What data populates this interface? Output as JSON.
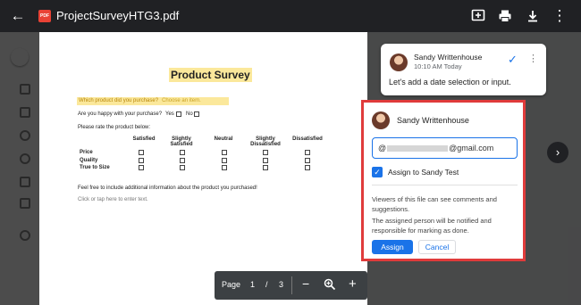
{
  "topbar": {
    "back_icon": "arrow-left-icon",
    "pdf_badge": "PDF",
    "file_title": "ProjectSurveyHTG3.pdf",
    "actions": [
      "add-comment-icon",
      "print-icon",
      "download-icon",
      "more-vert-icon"
    ]
  },
  "document": {
    "title": "Product Survey",
    "q1": "Which product did you purchase?",
    "q1_placeholder": "Choose an item.",
    "q2": "Are you happy with your purchase?",
    "yes": "Yes",
    "no": "No",
    "q3": "Please rate the product below:",
    "rating_columns": [
      "Satisfied",
      "Slightly Satisfied",
      "Neutral",
      "Slightly Dissatisfied",
      "Dissatisfied"
    ],
    "rating_rows": [
      "Price",
      "Quality",
      "True to Size"
    ],
    "q4": "Feel free to include additional information about the product you purchased!",
    "q4_placeholder": "Click or tap here to enter text."
  },
  "pagebar": {
    "page_label": "Page",
    "current": "1",
    "separator": "/",
    "total": "3",
    "zoom_out": "−",
    "zoom_in": "+"
  },
  "comment": {
    "author": "Sandy Writtenhouse",
    "time": "10:10 AM Today",
    "text": "Let's add a date selection or input."
  },
  "assign": {
    "author": "Sandy Writtenhouse",
    "email_prefix": "@",
    "email_suffix": "@gmail.com",
    "checkbox_label": "Assign to Sandy Test",
    "info1": "Viewers of this file can see comments and suggestions.",
    "info2": "The assigned person will be notified and responsible for marking as done.",
    "assign_label": "Assign",
    "cancel_label": "Cancel"
  },
  "colors": {
    "accent": "#1a73e8",
    "highlight_box": "#e03b3b",
    "pdf_red": "#e94235"
  }
}
